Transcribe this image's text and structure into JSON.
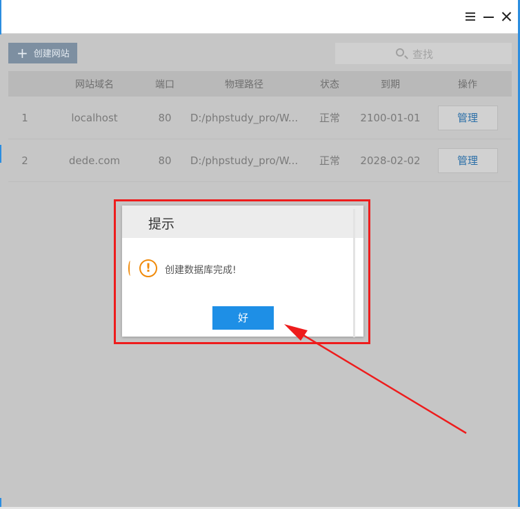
{
  "window": {
    "accent": "#2b8de0",
    "controls": {
      "menu_icon": "hamburger-menu-icon",
      "minimize_icon": "minimize-icon",
      "close_icon": "close-icon"
    }
  },
  "toolbar": {
    "create_label": "创建网站",
    "create_icon": "plus-icon",
    "search_label": "查找",
    "search_icon": "search-icon"
  },
  "table": {
    "headers": [
      "网站域名",
      "端口",
      "物理路径",
      "状态",
      "到期",
      "操作"
    ],
    "rows": [
      {
        "index": "1",
        "domain": "localhost",
        "port": "80",
        "path": "D:/phpstudy_pro/W...",
        "status": "正常",
        "expire": "2100-01-01",
        "action": "管理"
      },
      {
        "index": "2",
        "domain": "dede.com",
        "port": "80",
        "path": "D:/phpstudy_pro/W...",
        "status": "正常",
        "expire": "2028-02-02",
        "action": "管理"
      }
    ]
  },
  "dialog": {
    "title": "提示",
    "message": "创建数据库完成!",
    "icon": "warning-icon",
    "ok_label": "好",
    "ok_color": "#1e8fe6"
  },
  "annotation": {
    "highlight_color": "#ee1c1c"
  }
}
